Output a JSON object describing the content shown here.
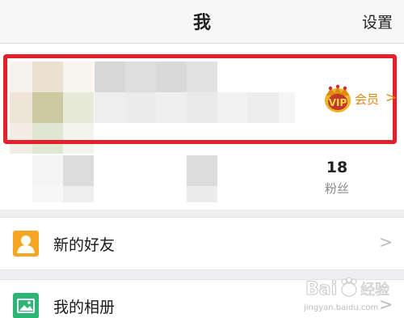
{
  "header": {
    "title": "我",
    "settings_label": "设置"
  },
  "profile": {
    "vip_label": "会员",
    "vip_chevron": ">",
    "fans_count": "18",
    "fans_label": "粉丝"
  },
  "list": [
    {
      "label": "新的好友",
      "icon": "person-icon",
      "icon_color": "#f5a623",
      "chevron": ">"
    },
    {
      "label": "我的相册",
      "icon": "photo-album-icon",
      "icon_color": "#2bb673",
      "chevron": ">"
    }
  ],
  "colors": {
    "accent": "#e7850e",
    "highlight": "#e4202c",
    "background": "#efeff2"
  },
  "watermark": {
    "brand": "Bai",
    "brand_suffix": "经验",
    "url": "jingyan.baidu.com"
  }
}
